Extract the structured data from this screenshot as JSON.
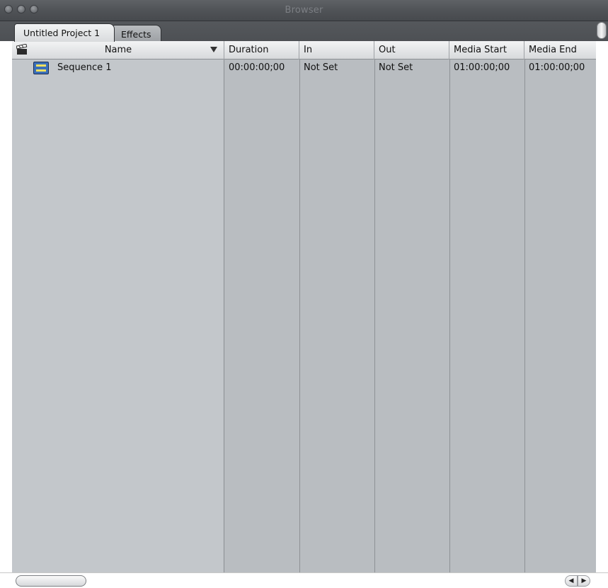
{
  "window": {
    "title": "Browser"
  },
  "tabs": [
    {
      "label": "Untitled Project 1",
      "active": true
    },
    {
      "label": "Effects",
      "active": false
    }
  ],
  "table": {
    "columns": [
      "Name",
      "Duration",
      "In",
      "Out",
      "Media Start",
      "Media End"
    ],
    "rows": [
      {
        "icon": "sequence-icon",
        "name": "Sequence 1",
        "duration": "00:00:00;00",
        "in": "Not Set",
        "out": "Not Set",
        "media_start": "01:00:00;00",
        "media_end": "01:00:00;00"
      }
    ]
  },
  "scrollbar": {
    "left_arrow": "◀",
    "right_arrow": "▶"
  }
}
